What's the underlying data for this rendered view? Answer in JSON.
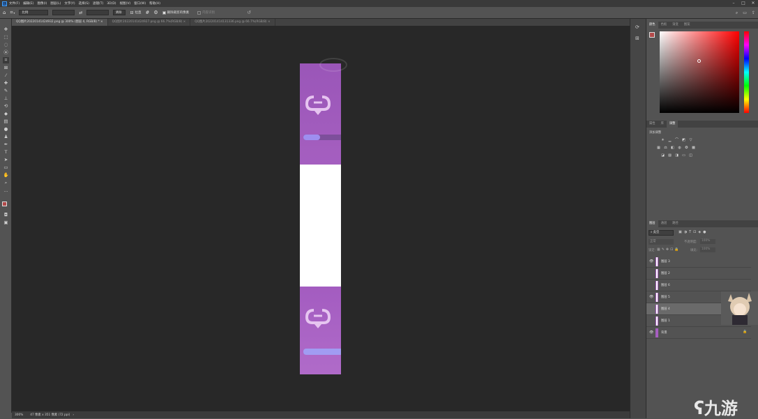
{
  "menu": {
    "logo": "Ps",
    "items": [
      "文件(F)",
      "编辑(E)",
      "图像(I)",
      "图层(L)",
      "文字(Y)",
      "选择(S)",
      "滤镜(T)",
      "3D(D)",
      "视图(V)",
      "窗口(W)",
      "帮助(H)"
    ]
  },
  "options_bar": {
    "ratio_label": "比例",
    "clear_label": "清除",
    "straighten_label": "拉直",
    "delete_cropped_label": "删除裁剪的像素",
    "content_aware_label": "内容识别"
  },
  "tabs": [
    {
      "label": "QQ图片20220141424932.png @ 300% (图层 4, RGB/8) *",
      "active": true
    },
    {
      "label": "QQ图片20220141424927.png @ 66.7%(RGB/8)",
      "active": false
    },
    {
      "label": "QQ图片202201414131336.png @ 66.7%(RGB/8)",
      "active": false
    }
  ],
  "status": {
    "zoom": "300%",
    "doc_info": "47 像素 x 351 像素 (72 ppi)"
  },
  "color_panel": {
    "tabs": [
      "颜色",
      "色板",
      "渐变",
      "图案"
    ],
    "foreground": "#b24a4a",
    "hue": "#ff0000"
  },
  "adjust_panel": {
    "tabs": [
      "属性",
      "库",
      "调整"
    ],
    "title": "添加调整"
  },
  "layers_panel": {
    "tabs": [
      "图层",
      "通道",
      "路径"
    ],
    "kind_label": "类型",
    "mode_label": "正常",
    "opacity_label": "不透明度:",
    "opacity_value": "100%",
    "lock_label": "锁定:",
    "fill_label": "填充:",
    "fill_value": "100%",
    "layers": [
      {
        "name": "图层 3",
        "visible": true,
        "selected": false
      },
      {
        "name": "图层 2",
        "visible": false,
        "selected": false
      },
      {
        "name": "图层 6",
        "visible": false,
        "selected": false
      },
      {
        "name": "图层 5",
        "visible": true,
        "selected": false
      },
      {
        "name": "图层 4",
        "visible": false,
        "selected": true
      },
      {
        "name": "图层 1",
        "visible": false,
        "selected": false
      },
      {
        "name": "背景",
        "visible": true,
        "selected": false
      }
    ]
  },
  "colors": {
    "purple": "#a65ec0",
    "purple_light": "#b570cc",
    "bar": "#9e8ef0",
    "canvas_bg": "#282828",
    "panel_bg": "#535353"
  },
  "watermark": "九游"
}
